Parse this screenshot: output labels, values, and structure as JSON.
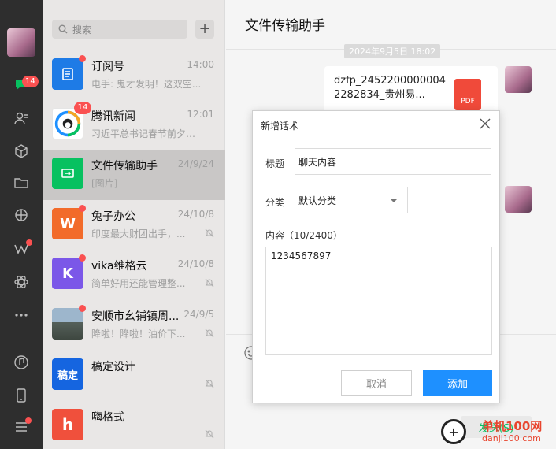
{
  "nav": {
    "chat_badge": "14"
  },
  "list": {
    "search_placeholder": "搜索",
    "add_label": "+",
    "items": [
      {
        "name": "订阅号",
        "time": "14:00",
        "preview": "电手: 鬼才发明！这双空...",
        "color": "#1e7be6",
        "glyph": "≡"
      },
      {
        "name": "腾讯新闻",
        "time": "12:01",
        "preview": "习近平总书记春节前夕赴...",
        "badge": "14",
        "color": "#ffffff",
        "glyph": ""
      },
      {
        "name": "文件传输助手",
        "time": "24/9/24",
        "preview": "[图片]",
        "color": "#07c160",
        "glyph": "⇄"
      },
      {
        "name": "兔子办公",
        "time": "24/10/8",
        "preview": "印度最大财团出手，...",
        "color": "#f26b2a",
        "glyph": "W"
      },
      {
        "name": "vika维格云",
        "time": "24/10/8",
        "preview": "简单好用还能管理整...",
        "color": "#7b57e8",
        "glyph": "K"
      },
      {
        "name": "安顺市幺铺镇周...",
        "time": "24/9/5",
        "preview": "降啦！降啦！油价下...",
        "color": "#7c8e9c",
        "glyph": ""
      },
      {
        "name": "稿定设计",
        "time": "",
        "preview": "",
        "color": "#1565e0",
        "glyph": "稿定"
      },
      {
        "name": "嗨格式",
        "time": "",
        "preview": "",
        "color": "#f0503c",
        "glyph": "h"
      }
    ]
  },
  "chat": {
    "title": "文件传输助手",
    "timestamp": "2024年9月5日 18:02",
    "file_name": "dzfp_2452200000004 2282834_贵州易...",
    "file_type": "PDF",
    "send_label": "发送(S)"
  },
  "dialog": {
    "title": "新增话术",
    "title_label": "标题",
    "title_value": "聊天内容",
    "category_label": "分类",
    "category_value": "默认分类",
    "content_label": "内容（10/2400）",
    "content_value": "1234567897",
    "cancel_label": "取消",
    "add_label": "添加"
  },
  "watermark": {
    "line1": "单机100网",
    "line2": "danji100.com"
  }
}
